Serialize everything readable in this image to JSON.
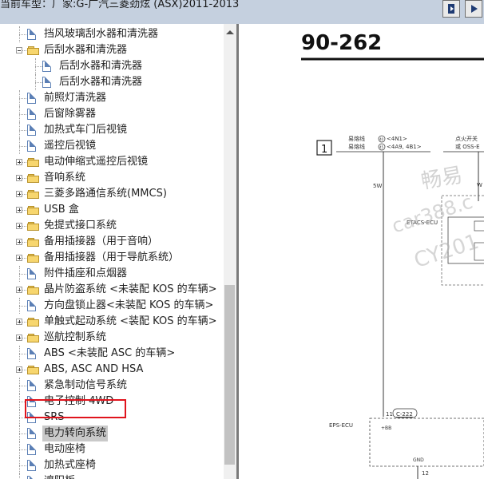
{
  "window": {
    "title": "当前车型：厂家:G-广汽三菱劲炫 (ASX)2011-2013"
  },
  "tree": {
    "items": [
      {
        "label": "挡风玻璃刮水器和清洗器",
        "type": "doc"
      },
      {
        "label": "后刮水器和清洗器",
        "type": "folder",
        "expanded": true
      },
      {
        "label": "后刮水器和清洗器",
        "type": "doc"
      },
      {
        "label": "后刮水器和清洗器",
        "type": "doc"
      },
      {
        "label": "前照灯清洗器",
        "type": "doc"
      },
      {
        "label": "后窗除雾器",
        "type": "doc"
      },
      {
        "label": "加热式车门后视镜",
        "type": "doc"
      },
      {
        "label": "遥控后视镜",
        "type": "doc"
      },
      {
        "label": "电动伸缩式遥控后视镜",
        "type": "folder"
      },
      {
        "label": "音响系统",
        "type": "folder"
      },
      {
        "label": "三菱多路通信系统(MMCS)",
        "type": "folder"
      },
      {
        "label": "USB 盒",
        "type": "folder"
      },
      {
        "label": "免提式接口系统",
        "type": "folder"
      },
      {
        "label": "备用插接器（用于音响）",
        "type": "folder"
      },
      {
        "label": "备用插接器（用于导航系统）",
        "type": "folder"
      },
      {
        "label": "附件插座和点烟器",
        "type": "doc"
      },
      {
        "label": "晶片防盗系统 <未装配 KOS 的车辆>",
        "type": "folder"
      },
      {
        "label": "方向盘锁止器<未装配 KOS 的车辆>",
        "type": "doc"
      },
      {
        "label": "单触式起动系统 <装配 KOS 的车辆>",
        "type": "folder"
      },
      {
        "label": "巡航控制系统",
        "type": "folder"
      },
      {
        "label": "ABS <未装配 ASC 的车辆>",
        "type": "doc"
      },
      {
        "label": "ABS, ASC AND HSA",
        "type": "folder"
      },
      {
        "label": "紧急制动信号系统",
        "type": "doc"
      },
      {
        "label": "电子控制 4WD",
        "type": "doc"
      },
      {
        "label": "SRS",
        "type": "doc"
      },
      {
        "label": "电力转向系统",
        "type": "doc",
        "selected": true
      },
      {
        "label": "电动座椅",
        "type": "doc"
      },
      {
        "label": "加热式座椅",
        "type": "doc"
      },
      {
        "label": "遮阳板",
        "type": "doc"
      }
    ]
  },
  "diagram": {
    "page_number": "90-262",
    "box_number": "1",
    "fuse_label_1": "易熔线",
    "fuse_label_2": "易熔线",
    "fuse_code_1": "<4N1>",
    "fuse_code_2": "<4A9, 4B1>",
    "fuse_num_1": "40",
    "fuse_num_2": "45",
    "ignition_label_1": "点火开关",
    "ignition_label_2": "或 OSS-E",
    "wire_5w": "5W",
    "wire_w": "W",
    "etacs_label": "ETACS-ECU",
    "pin_number": "11",
    "connector": "C-222",
    "eps_label": "EPS-ECU",
    "bb_label": "+BB",
    "gnd_label": "GND",
    "pin_12": "12",
    "watermark_1": "畅易",
    "watermark_2": "car388.c",
    "watermark_3": "CY201"
  }
}
